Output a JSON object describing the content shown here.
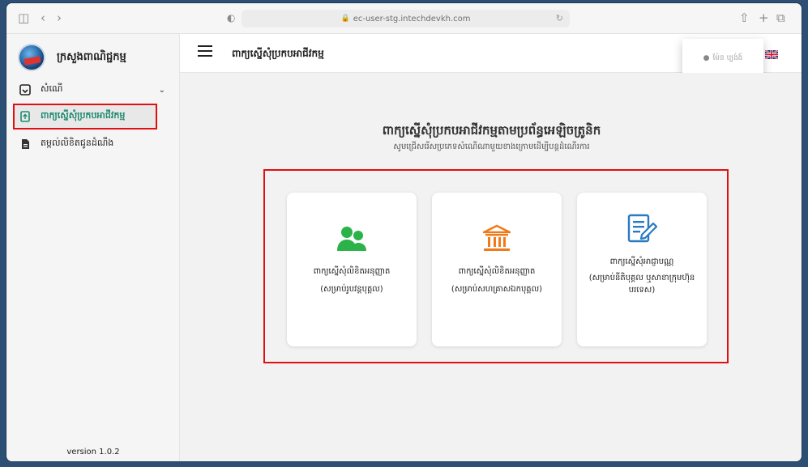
{
  "browser": {
    "url": "ec-user-stg.intechdevkh.com"
  },
  "sidebar": {
    "brand_name": "ក្រសួងពាណិជ្ជកម្ម",
    "items": [
      {
        "label": "សំណើ",
        "icon": "inbox-icon"
      },
      {
        "label": "ពាក្យស្នើសុំប្រកបអាជីវកម្ម",
        "icon": "upload-file-icon",
        "active": true
      },
      {
        "label": "តម្កល់លិខិតជូនដំណឹង",
        "icon": "document-icon"
      }
    ],
    "version": "version 1.0.2"
  },
  "topbar": {
    "title": "ពាក្យស្នើសុំប្រកបអាជីវកម្ម",
    "user_name": "ម៉ែន ប្បង់ង៍"
  },
  "main": {
    "heading": "ពាក្យស្នើសុំប្រកបអាជីវកម្មតាមប្រព័ន្ធអេឡិចត្រូនិក",
    "subheading": "សូមជ្រើសរើសប្រភេទសំណើណាមួយខាងក្រោមដើម្បីបន្តដំណើរការ",
    "cards": [
      {
        "title": "ពាក្យស្នើសុំលិខិតអនុញ្ញាត",
        "subtitle": "(សម្រាប់រូបវន្តបុគ្គល)",
        "icon": "people-icon",
        "color": "#2bb34a"
      },
      {
        "title": "ពាក្យស្នើសុំលិខិតអនុញ្ញាត",
        "subtitle": "(សម្រាប់សហគ្រាសឯកបុគ្គល)",
        "icon": "bank-icon",
        "color": "#f07a1a"
      },
      {
        "title": "ពាក្យស្នើសុំអាជ្ញាបណ្ណ",
        "subtitle": "(សម្រាប់នីតិបុគ្គល ឬសាខាក្រុមហ៊ុនបរទេស)",
        "icon": "edit-document-icon",
        "color": "#2a7ac0"
      }
    ]
  },
  "colors": {
    "highlight_border": "#e10f0f",
    "active_text": "#1f8a70"
  }
}
